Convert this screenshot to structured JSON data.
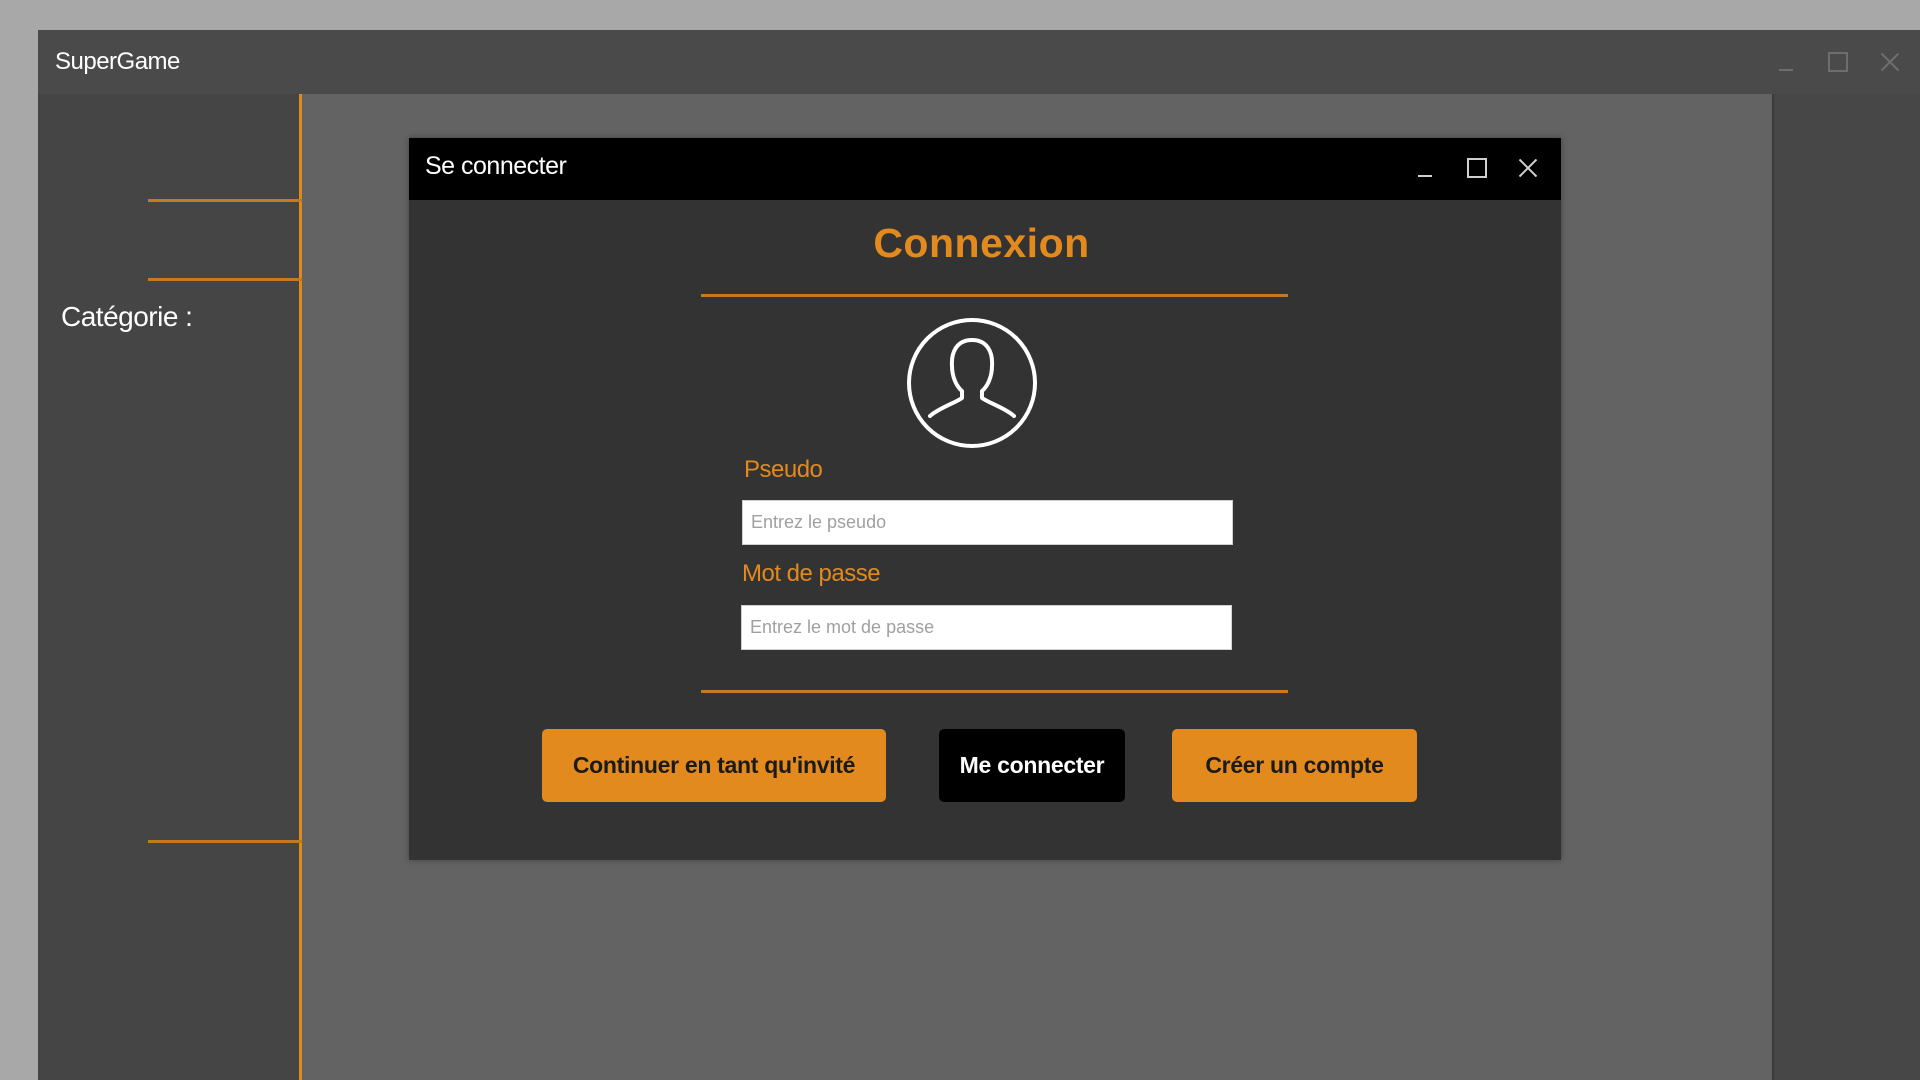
{
  "app": {
    "title": "SuperGame",
    "sidebar": {
      "category_label": "Catégorie :"
    }
  },
  "dialog": {
    "title": "Se connecter",
    "heading": "Connexion",
    "pseudo": {
      "label": "Pseudo",
      "placeholder": "Entrez le pseudo",
      "value": ""
    },
    "password": {
      "label": "Mot de passe",
      "placeholder": "Entrez le mot de passe",
      "value": ""
    },
    "buttons": {
      "guest": "Continuer en tant qu'invité",
      "login": "Me connecter",
      "create": "Créer un compte"
    },
    "avatar_icon": "user-silhouette-icon"
  },
  "colors": {
    "accent": "#e38a1f",
    "dialog_background": "#333333",
    "dialog_titlebar": "#000000",
    "app_background": "#636363",
    "sidebar_background": "#454545"
  }
}
